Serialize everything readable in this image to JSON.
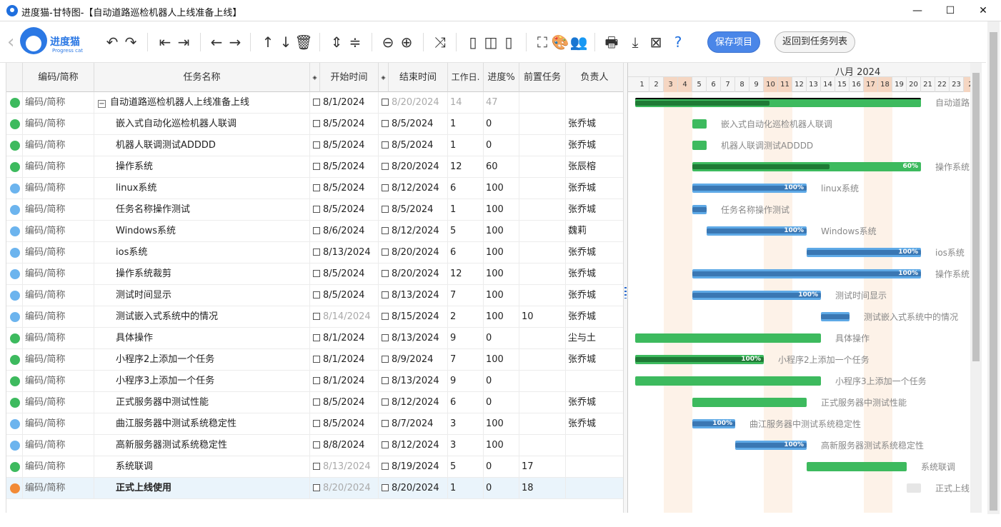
{
  "window": {
    "title": "进度猫-甘特图-【自动道路巡检机器人上线准备上线】",
    "minimize": "—",
    "maximize": "☐",
    "close": "✕"
  },
  "toolbar": {
    "logo_text": "进度猫",
    "logo_sub": "Progress cat",
    "save_label": "保存项目",
    "return_label": "返回到任务列表"
  },
  "columns": {
    "code": "编码/简称",
    "name": "任务名称",
    "start": "开始时间",
    "end": "结束时间",
    "workdays": "工作日.",
    "progress": "进度%",
    "predecessor": "前置任务",
    "owner": "负责人"
  },
  "gantt_header": {
    "month": "八月 2024",
    "days": [
      "1",
      "2",
      "3",
      "4",
      "5",
      "6",
      "7",
      "8",
      "9",
      "10",
      "11",
      "12",
      "13",
      "14",
      "15",
      "16",
      "17",
      "18",
      "19",
      "20",
      "21",
      "22",
      "23",
      "2"
    ]
  },
  "colors": {
    "green": "#3dba5e",
    "blue": "#6cb4ee",
    "orange": "#f28a36",
    "dark_green": "#1f7a35",
    "bar_blue": "#3a77b3",
    "light_blue": "#5ea9e6"
  },
  "tasks": [
    {
      "code": "编码/简称",
      "name": "自动道路巡检机器人上线准备上线",
      "start": "8/1/2024",
      "end": "8/20/2024",
      "workdays": "14",
      "progress": "47",
      "pred": "",
      "owner": "",
      "status": "green",
      "indent": 0,
      "collapse": "−",
      "end_dim": true,
      "wd_dim": true,
      "start_dim": false,
      "label": "自动道路"
    },
    {
      "code": "编码/简称",
      "name": "嵌入式自动化巡检机器人联调",
      "start": "8/5/2024",
      "end": "8/5/2024",
      "workdays": "1",
      "progress": "0",
      "pred": "",
      "owner": "张乔城",
      "status": "green",
      "indent": 1,
      "label": "嵌入式自动化巡检机器人联调"
    },
    {
      "code": "编码/简称",
      "name": "机器人联调测试ADDDD",
      "start": "8/5/2024",
      "end": "8/5/2024",
      "workdays": "1",
      "progress": "0",
      "pred": "",
      "owner": "张乔城",
      "status": "green",
      "indent": 1,
      "label": "机器人联调测试ADDDD"
    },
    {
      "code": "编码/简称",
      "name": "操作系统",
      "start": "8/5/2024",
      "end": "8/20/2024",
      "workdays": "12",
      "progress": "60",
      "pred": "",
      "owner": "张辰榕",
      "status": "green",
      "indent": 1,
      "label": "操作系统",
      "pct": "60%"
    },
    {
      "code": "编码/简称",
      "name": "linux系统",
      "start": "8/5/2024",
      "end": "8/12/2024",
      "workdays": "6",
      "progress": "100",
      "pred": "",
      "owner": "张乔城",
      "status": "blue",
      "indent": 1,
      "label": "linux系统",
      "pct": "100%"
    },
    {
      "code": "编码/简称",
      "name": "任务名称操作测试",
      "start": "8/5/2024",
      "end": "8/5/2024",
      "workdays": "1",
      "progress": "100",
      "pred": "",
      "owner": "张乔城",
      "status": "blue",
      "indent": 1,
      "label": "任务名称操作测试"
    },
    {
      "code": "编码/简称",
      "name": "Windows系统",
      "start": "8/6/2024",
      "end": "8/12/2024",
      "workdays": "5",
      "progress": "100",
      "pred": "",
      "owner": "魏莉",
      "status": "blue",
      "indent": 1,
      "label": "Windows系统",
      "pct": "100%"
    },
    {
      "code": "编码/简称",
      "name": "ios系统",
      "start": "8/13/2024",
      "end": "8/20/2024",
      "workdays": "6",
      "progress": "100",
      "pred": "",
      "owner": "张乔城",
      "status": "blue",
      "indent": 1,
      "label": "ios系统",
      "pct": "100%"
    },
    {
      "code": "编码/简称",
      "name": "操作系统裁剪",
      "start": "8/5/2024",
      "end": "8/20/2024",
      "workdays": "12",
      "progress": "100",
      "pred": "",
      "owner": "张乔城",
      "status": "blue",
      "indent": 1,
      "label": "操作系统",
      "pct": "100%"
    },
    {
      "code": "编码/简称",
      "name": "测试时间显示",
      "start": "8/5/2024",
      "end": "8/13/2024",
      "workdays": "7",
      "progress": "100",
      "pred": "",
      "owner": "张乔城",
      "status": "blue",
      "indent": 1,
      "label": "测试时间显示",
      "pct": "100%"
    },
    {
      "code": "编码/简称",
      "name": "测试嵌入式系统中的情况",
      "start": "8/14/2024",
      "end": "8/15/2024",
      "workdays": "2",
      "progress": "100",
      "pred": "10",
      "owner": "张乔城",
      "status": "blue",
      "indent": 1,
      "start_dim": true,
      "label": "测试嵌入式系统中的情况"
    },
    {
      "code": "编码/简称",
      "name": "具体操作",
      "start": "8/1/2024",
      "end": "8/13/2024",
      "workdays": "9",
      "progress": "0",
      "pred": "",
      "owner": "尘与土",
      "status": "green",
      "indent": 1,
      "label": "具体操作"
    },
    {
      "code": "编码/简称",
      "name": "小程序2上添加一个任务",
      "start": "8/1/2024",
      "end": "8/9/2024",
      "workdays": "7",
      "progress": "100",
      "pred": "",
      "owner": "张乔城",
      "status": "green",
      "indent": 1,
      "label": "小程序2上添加一个任务",
      "pct": "100%"
    },
    {
      "code": "编码/简称",
      "name": "小程序3上添加一个任务",
      "start": "8/1/2024",
      "end": "8/13/2024",
      "workdays": "9",
      "progress": "0",
      "pred": "",
      "owner": "",
      "status": "green",
      "indent": 1,
      "label": "小程序3上添加一个任务"
    },
    {
      "code": "编码/简称",
      "name": "正式服务器中测试性能",
      "start": "8/5/2024",
      "end": "8/12/2024",
      "workdays": "6",
      "progress": "0",
      "pred": "",
      "owner": "张乔城",
      "status": "green",
      "indent": 1,
      "label": "正式服务器中测试性能"
    },
    {
      "code": "编码/简称",
      "name": "曲江服务器中测试系统稳定性",
      "start": "8/5/2024",
      "end": "8/7/2024",
      "workdays": "3",
      "progress": "100",
      "pred": "",
      "owner": "张乔城",
      "status": "blue",
      "indent": 1,
      "label": "曲江服务器中测试系统稳定性",
      "pct": "100%"
    },
    {
      "code": "编码/简称",
      "name": "高新服务器测试系统稳定性",
      "start": "8/8/2024",
      "end": "8/12/2024",
      "workdays": "3",
      "progress": "100",
      "pred": "",
      "owner": "",
      "status": "blue",
      "indent": 1,
      "label": "高新服务器测试系统稳定性",
      "pct": "100%"
    },
    {
      "code": "编码/简称",
      "name": "系统联调",
      "start": "8/13/2024",
      "end": "8/19/2024",
      "workdays": "5",
      "progress": "0",
      "pred": "17",
      "owner": "",
      "status": "green",
      "indent": 1,
      "start_dim": true,
      "label": "系统联调"
    },
    {
      "code": "编码/简称",
      "name": "正式上线使用",
      "start": "8/20/2024",
      "end": "8/20/2024",
      "workdays": "1",
      "progress": "0",
      "pred": "18",
      "owner": "",
      "status": "orange",
      "indent": 1,
      "start_dim": true,
      "selected": true,
      "label": "正式上线"
    }
  ]
}
